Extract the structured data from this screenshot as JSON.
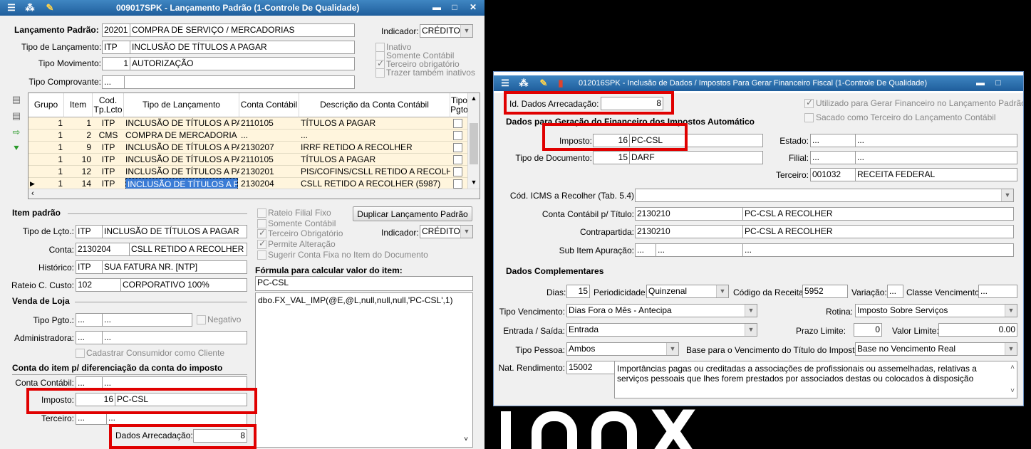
{
  "left": {
    "title": "009017SPK - Lançamento Padrão (1-Controle De Qualidade)",
    "lanc_padrao": {
      "label": "Lançamento Padrão:",
      "code": "20201",
      "desc": "COMPRA DE SERVIÇO / MERCADORIAS"
    },
    "tipo_lancamento": {
      "label": "Tipo de Lançamento:",
      "code": "ITP",
      "desc": "INCLUSÃO DE TÍTULOS A PAGAR"
    },
    "tipo_movimento": {
      "label": "Tipo Movimento:",
      "code": "1",
      "desc": "AUTORIZAÇÃO"
    },
    "tipo_comprovante": {
      "label": "Tipo Comprovante:",
      "code": "...",
      "desc": ""
    },
    "indicador": {
      "label": "Indicador:",
      "value": "CRÉDITO"
    },
    "checks": {
      "inativo": "Inativo",
      "somente_contabil": "Somente Contábil",
      "terceiro_obrigatorio": "Terceiro obrigatório",
      "trazer_inativos": "Trazer também inativos"
    },
    "grid": {
      "headers": [
        "Grupo",
        "Item",
        "Cod. Tp.Lcto",
        "Tipo de Lançamento",
        "Conta Contábil",
        "Descrição da Conta Contábil",
        "Tipo Pgto"
      ],
      "rows": [
        [
          "1",
          "1",
          "ITP",
          "INCLUSÃO DE TÍTULOS A PAGA",
          "2110105",
          "TÍTULOS A PAGAR"
        ],
        [
          "1",
          "2",
          "CMS",
          "COMPRA DE MERCADORIA E S...",
          "...",
          "..."
        ],
        [
          "1",
          "9",
          "ITP",
          "INCLUSÃO DE TÍTULOS A PAGA",
          "2130207",
          "IRRF RETIDO A RECOLHER"
        ],
        [
          "1",
          "10",
          "ITP",
          "INCLUSÃO DE TÍTULOS A PAGA",
          "2110105",
          "TÍTULOS A PAGAR"
        ],
        [
          "1",
          "12",
          "ITP",
          "INCLUSÃO DE TÍTULOS A PAGA",
          "2130201",
          "PIS/COFINS/CSLL RETIDO A RECOLHER ("
        ],
        [
          "1",
          "14",
          "ITP",
          "INCLUSÃO DE TÍTULOS A PAG",
          "2130204",
          "CSLL RETIDO A RECOLHER (5987)"
        ]
      ]
    },
    "item_padrao": {
      "header": "Item padrão",
      "tipo_lcto": {
        "label": "Tipo de Lçto.:",
        "code": "ITP",
        "desc": "INCLUSÃO DE TÍTULOS A PAGAR"
      },
      "conta": {
        "label": "Conta:",
        "code": "2130204",
        "desc": "CSLL RETIDO A RECOLHER (598"
      },
      "historico": {
        "label": "Histórico:",
        "code": "ITP",
        "desc": "SUA FATURA NR. [NTP]"
      },
      "rateio": {
        "label": "Rateio C. Custo:",
        "code": "102",
        "desc": "CORPORATIVO 100%"
      }
    },
    "item_checks": {
      "rateio_filial": "Rateio Filial Fixo",
      "somente_contabil": "Somente Contábil",
      "terceiro_obrigatorio": "Terceiro Obrigatório",
      "permite_alteracao": "Permite Alteração",
      "sugerir_conta": "Sugerir Conta Fixa no Item do Documento"
    },
    "duplicar_button": "Duplicar Lançamento Padrão",
    "indicador2": {
      "label": "Indicador:",
      "value": "CRÉDITO"
    },
    "formula": {
      "label": "Fórmula para calcular valor do item:",
      "name": "PC-CSL",
      "expr": "dbo.FX_VAL_IMP(@E,@L,null,null,null,'PC-CSL',1)"
    },
    "venda_loja": {
      "header": "Venda de Loja",
      "tipo_pgto": {
        "label": "Tipo Pgto.:",
        "code": "...",
        "desc": "..."
      },
      "negativo": "Negativo",
      "administradora": {
        "label": "Administradora:",
        "code": "...",
        "desc": "..."
      },
      "cadastrar": "Cadastrar Consumidor como Cliente"
    },
    "conta_item": {
      "header": "Conta do item p/ diferenciação da conta do imposto",
      "conta_contabil": {
        "label": "Conta Contábil:",
        "code": "...",
        "desc": "..."
      },
      "imposto": {
        "label": "Imposto:",
        "code": "16",
        "desc": "PC-CSL"
      },
      "terceiro": {
        "label": "Terceiro:",
        "code": "...",
        "desc": "..."
      },
      "dados_arrecadacao": {
        "label": "Dados Arrecadação:",
        "value": "8"
      }
    }
  },
  "right": {
    "title": "012016SPK - Inclusão de Dados / Impostos  Para Gerar Financeiro Fiscal (1-Controle De Qualidade)",
    "id_dados": {
      "label": "Id. Dados Arrecadação:",
      "value": "8"
    },
    "checks": {
      "utilizado": "Utilizado para Gerar Financeiro no Lançamento Padrão",
      "sacado": "Sacado como Terceiro do Lançamento Contábil"
    },
    "header1": "Dados para Geração do Financeiro dos Impostos Automático",
    "imposto": {
      "label": "Imposto:",
      "code": "16",
      "desc": "PC-CSL"
    },
    "tipo_documento": {
      "label": "Tipo de Documento:",
      "code": "15",
      "desc": "DARF"
    },
    "estado": {
      "label": "Estado:",
      "code": "...",
      "desc": "..."
    },
    "filial": {
      "label": "Filial:",
      "code": "...",
      "desc": "..."
    },
    "terceiro": {
      "label": "Terceiro:",
      "code": "001032",
      "desc": "RECEITA FEDERAL"
    },
    "cod_icms": {
      "label": "Cód. ICMS a Recolher (Tab. 5.4)",
      "value": ""
    },
    "conta_titulo": {
      "label": "Conta Contábil p/ Título:",
      "code": "2130210",
      "desc": "PC-CSL A RECOLHER"
    },
    "contrapartida": {
      "label": "Contrapartida:",
      "code": "2130210",
      "desc": "PC-CSL A RECOLHER"
    },
    "sub_item": {
      "label": "Sub Item Apuração:",
      "code": "...",
      "code2": "...",
      "desc": "..."
    },
    "header2": "Dados Complementares",
    "dias": {
      "label": "Dias:",
      "value": "15"
    },
    "periodicidade": {
      "label": "Periodicidade:",
      "value": "Quinzenal"
    },
    "cod_receita": {
      "label": "Código da Receita:",
      "value": "5952"
    },
    "variacao": {
      "label": "Variação:",
      "value": "..."
    },
    "classe_venc": {
      "label": "Classe Vencimento:",
      "value": "..."
    },
    "tipo_venc": {
      "label": "Tipo Vencimento:",
      "value": "Dias Fora o Mês - Antecipa"
    },
    "rotina": {
      "label": "Rotina:",
      "value": "Imposto Sobre Serviços"
    },
    "entrada_saida": {
      "label": "Entrada / Saída:",
      "value": "Entrada"
    },
    "prazo_limite": {
      "label": "Prazo Limite:",
      "value": "0"
    },
    "valor_limite": {
      "label": "Valor Limite:",
      "value": "0.00"
    },
    "tipo_pessoa": {
      "label": "Tipo Pessoa:",
      "value": "Ambos"
    },
    "base_venc": {
      "label": "Base para o Vencimento do Título do Imposto:",
      "value": "Base no Vencimento Real"
    },
    "nat_rendimento": {
      "label": "Nat. Rendimento:",
      "code": "15002",
      "desc": "Importâncias pagas ou creditadas a associações de profissionais ou assemelhadas, relativas a serviços pessoais que lhes forem prestados por associados destas ou colocados à disposição"
    }
  },
  "colors": {
    "titlebar": "#2b6cab",
    "highlight_row": "#fff5dd",
    "selection": "#3a7bd5",
    "annotation": "#e00000"
  }
}
